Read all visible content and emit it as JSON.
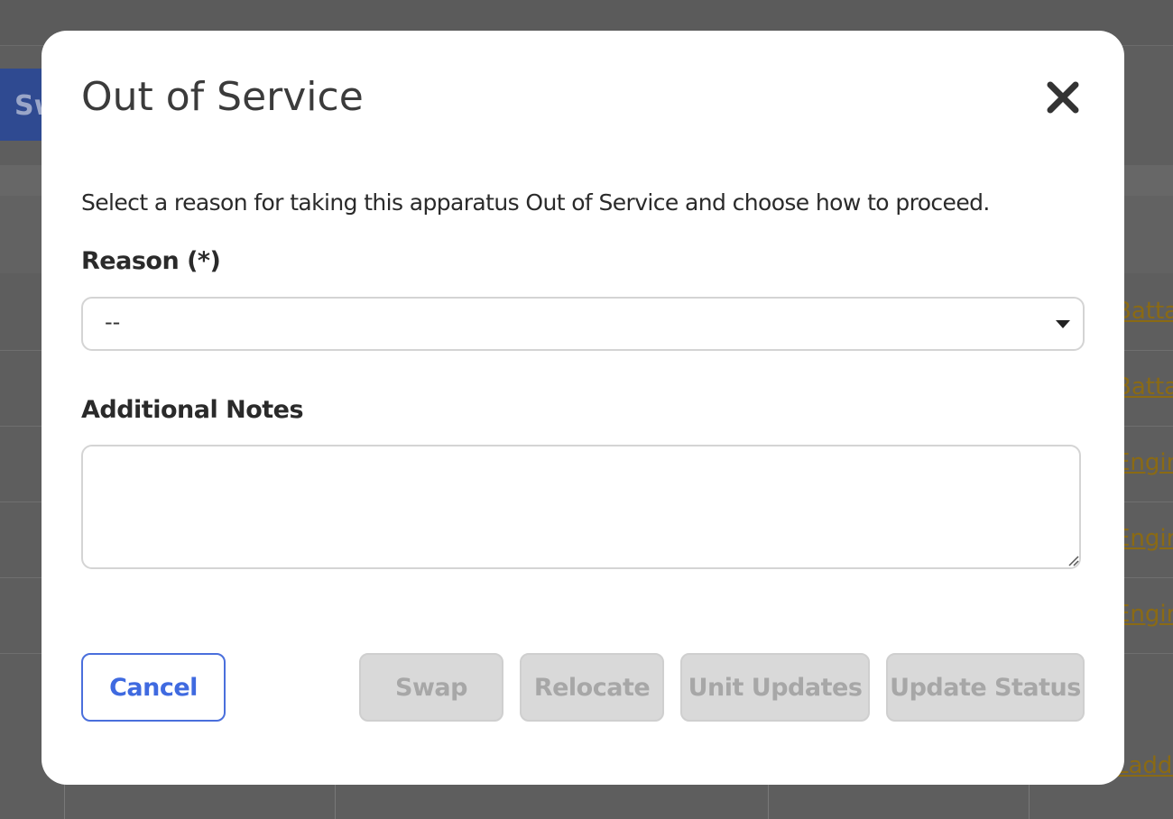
{
  "background": {
    "partial_button_text": "Sw",
    "partial_links": [
      "Batta",
      "Batta",
      "Engin",
      "Engin",
      "Engin",
      "Ladde"
    ]
  },
  "modal": {
    "title": "Out of Service",
    "description": "Select a reason for taking this apparatus Out of Service and choose how to proceed.",
    "reason": {
      "label": "Reason (*)",
      "selected_value": "--"
    },
    "notes": {
      "label": "Additional Notes",
      "value": ""
    },
    "buttons": {
      "cancel": "Cancel",
      "swap": "Swap",
      "relocate": "Relocate",
      "unit_updates": "Unit Updates",
      "update_status": "Update Status"
    }
  },
  "colors": {
    "overlay": "#5e5e5e",
    "accent": "#3f6ae0",
    "disabled_bg": "#d9d9d9",
    "disabled_text": "#a7a7a7"
  }
}
